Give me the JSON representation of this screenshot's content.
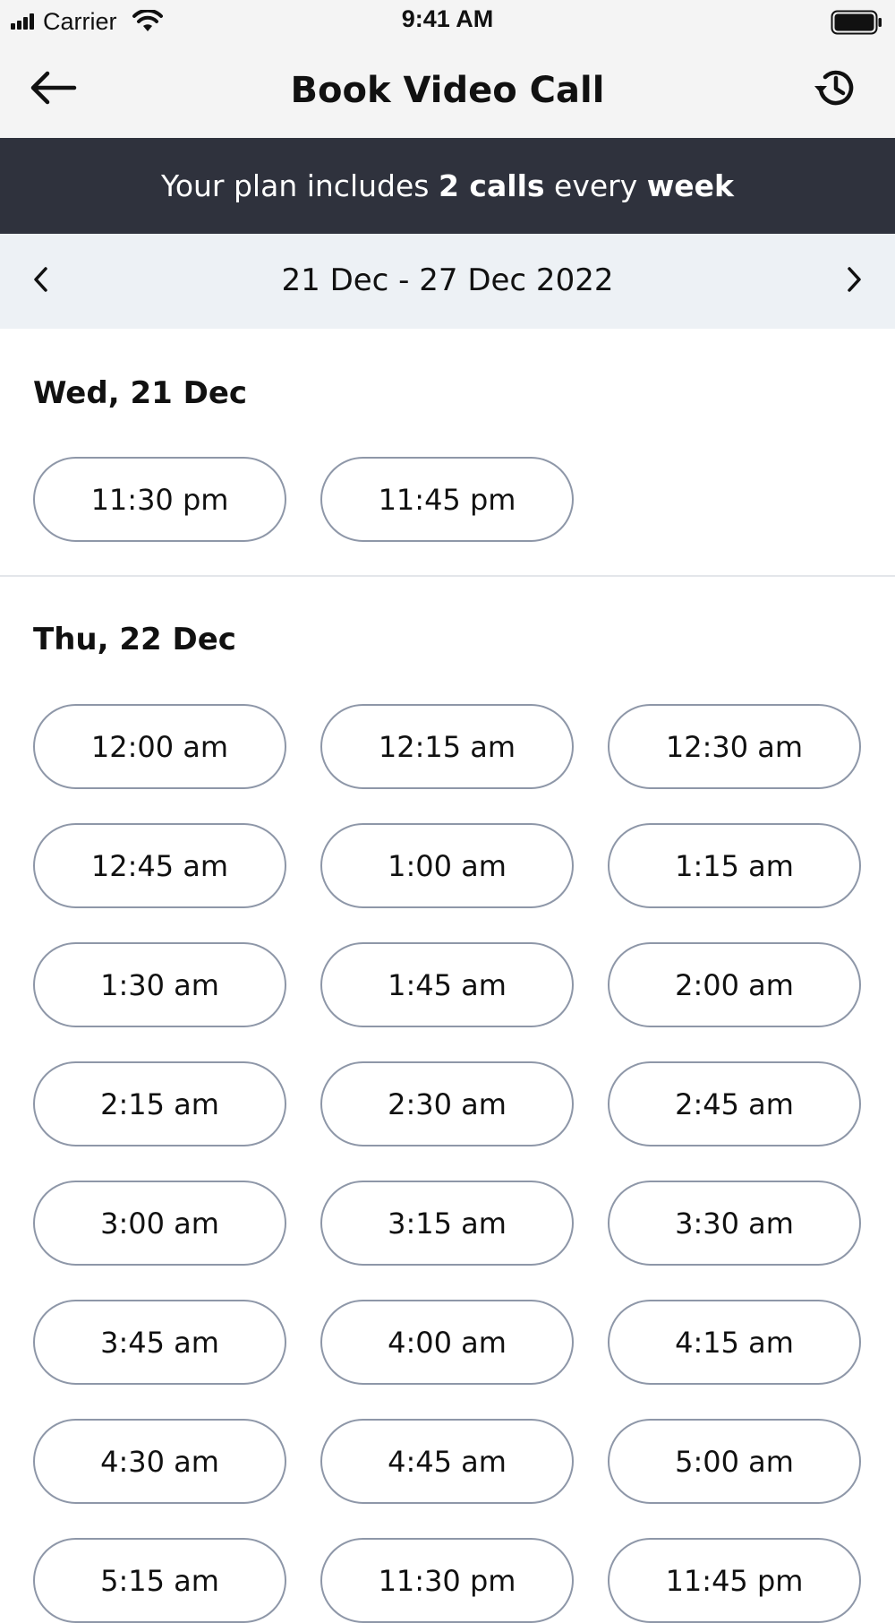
{
  "status_bar": {
    "carrier": "Carrier",
    "time": "9:41 AM",
    "icons": [
      "signal-icon",
      "wifi-icon",
      "battery-icon"
    ]
  },
  "nav": {
    "title": "Book Video Call",
    "back_icon": "arrow-left-icon",
    "history_icon": "history-icon"
  },
  "plan_banner": {
    "prefix": "Your plan includes ",
    "calls": "2 calls",
    "middle": " every ",
    "period": "week"
  },
  "week_selector": {
    "label": "21 Dec - 27 Dec 2022",
    "prev_icon": "chevron-left-icon",
    "next_icon": "chevron-right-icon"
  },
  "days": [
    {
      "heading": "Wed, 21 Dec",
      "slots": [
        "11:30 pm",
        "11:45 pm"
      ]
    },
    {
      "heading": "Thu, 22 Dec",
      "slots": [
        "12:00 am",
        "12:15 am",
        "12:30 am",
        "12:45 am",
        "1:00 am",
        "1:15 am",
        "1:30 am",
        "1:45 am",
        "2:00 am",
        "2:15 am",
        "2:30 am",
        "2:45 am",
        "3:00 am",
        "3:15 am",
        "3:30 am",
        "3:45 am",
        "4:00 am",
        "4:15 am",
        "4:30 am",
        "4:45 am",
        "5:00 am",
        "5:15 am",
        "11:30 pm",
        "11:45 pm"
      ]
    }
  ],
  "colors": {
    "banner_bg": "#2f323d",
    "week_bg": "#edf1f5",
    "header_bg": "#f4f4f4",
    "slot_border": "#8e97a8"
  }
}
